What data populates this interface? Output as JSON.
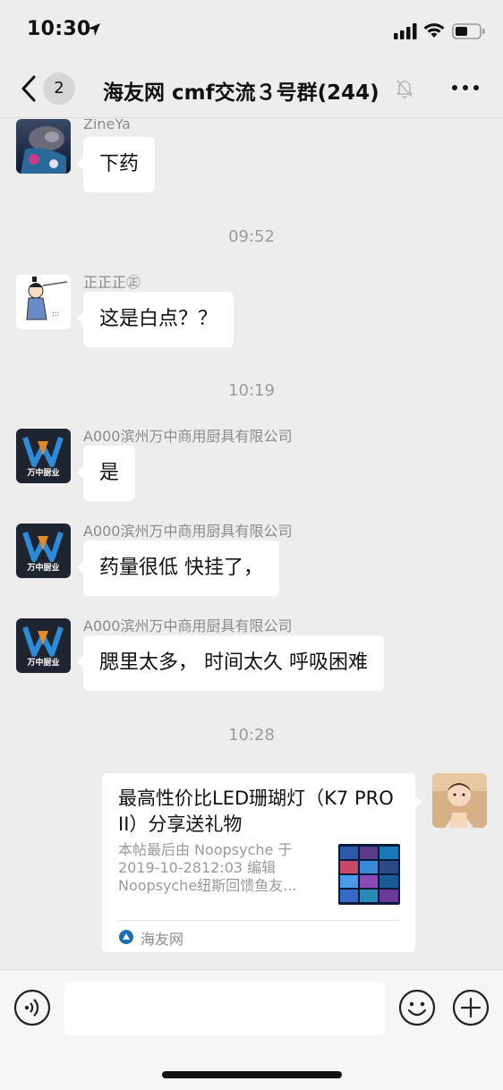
{
  "status_bar": {
    "time": "10:30"
  },
  "nav": {
    "unread_count": "2",
    "title": "海友网 cmf交流３号群(244)"
  },
  "messages": [
    {
      "sender": "ZineYa",
      "text": "下药"
    },
    {
      "timestamp": "09:52"
    },
    {
      "sender": "正正正㊣",
      "text": "这是白点？？"
    },
    {
      "timestamp": "10:19"
    },
    {
      "sender": "A000滨州万中商用厨具有限公司",
      "text": "是"
    },
    {
      "sender": "A000滨州万中商用厨具有限公司",
      "text": "药量很低 快挂了，"
    },
    {
      "sender": "A000滨州万中商用厨具有限公司",
      "text": "腮里太多， 时间太久 呼吸困难"
    },
    {
      "timestamp": "10:28"
    }
  ],
  "link_card": {
    "title": "最高性价比LED珊瑚灯（K7 PRO II）分享送礼物",
    "description": "本帖最后由 Noopsyche 于 2019-10-2812:03 编辑 Noopsyche纽斯回馈鱼友...",
    "source": "海友网"
  },
  "company_logo_text": "万中厨业",
  "colors": {
    "background": "#ededed",
    "bubble": "#ffffff",
    "timestamp": "#9b9b9b",
    "sender": "#8a8a8a",
    "source_icon": "#1a6fb0"
  },
  "icons": [
    "location-arrow-icon",
    "signal-icon",
    "wifi-icon",
    "battery-icon",
    "back-chevron-icon",
    "mute-bell-icon",
    "more-dots-icon",
    "voice-icon",
    "emoji-icon",
    "plus-icon"
  ]
}
